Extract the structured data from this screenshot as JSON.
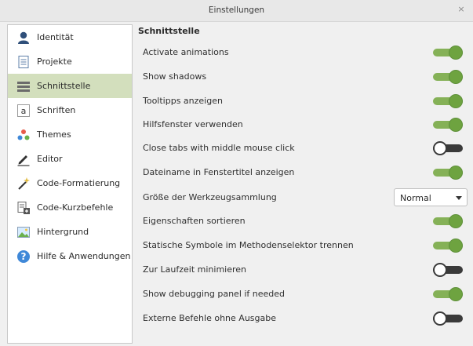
{
  "window": {
    "title": "Einstellungen",
    "close_glyph": "×"
  },
  "sidebar": {
    "items": [
      {
        "label": "Identität",
        "icon": "user-icon"
      },
      {
        "label": "Projekte",
        "icon": "document-icon"
      },
      {
        "label": "Schnittstelle",
        "icon": "interface-icon",
        "active": true
      },
      {
        "label": "Schriften",
        "icon": "font-icon"
      },
      {
        "label": "Themes",
        "icon": "themes-icon"
      },
      {
        "label": "Editor",
        "icon": "pen-icon"
      },
      {
        "label": "Code-Formatierung",
        "icon": "magic-wand-icon"
      },
      {
        "label": "Code-Kurzbefehle",
        "icon": "shortcut-icon"
      },
      {
        "label": "Hintergrund",
        "icon": "image-icon"
      },
      {
        "label": "Hilfe & Anwendungen",
        "icon": "help-icon"
      }
    ]
  },
  "main": {
    "section_title": "Schnittstelle",
    "settings": [
      {
        "label": "Activate animations",
        "type": "toggle",
        "value": true
      },
      {
        "label": "Show shadows",
        "type": "toggle",
        "value": true
      },
      {
        "label": "Tooltipps anzeigen",
        "type": "toggle",
        "value": true
      },
      {
        "label": "Hilfsfenster verwenden",
        "type": "toggle",
        "value": true
      },
      {
        "label": "Close tabs with middle mouse click",
        "type": "toggle",
        "value": false
      },
      {
        "label": "Dateiname in Fenstertitel anzeigen",
        "type": "toggle",
        "value": true
      },
      {
        "label": "Größe der Werkzeugsammlung",
        "type": "select",
        "value": "Normal"
      },
      {
        "label": "Eigenschaften sortieren",
        "type": "toggle",
        "value": true
      },
      {
        "label": "Statische Symbole im Methodenselektor trennen",
        "type": "toggle",
        "value": true
      },
      {
        "label": "Zur Laufzeit minimieren",
        "type": "toggle",
        "value": false
      },
      {
        "label": "Show debugging panel if needed",
        "type": "toggle",
        "value": true
      },
      {
        "label": "Externe Befehle ohne Ausgabe",
        "type": "toggle",
        "value": false
      }
    ]
  },
  "colors": {
    "accent": "#6ea340",
    "active_sidebar": "#d3dfbd"
  }
}
